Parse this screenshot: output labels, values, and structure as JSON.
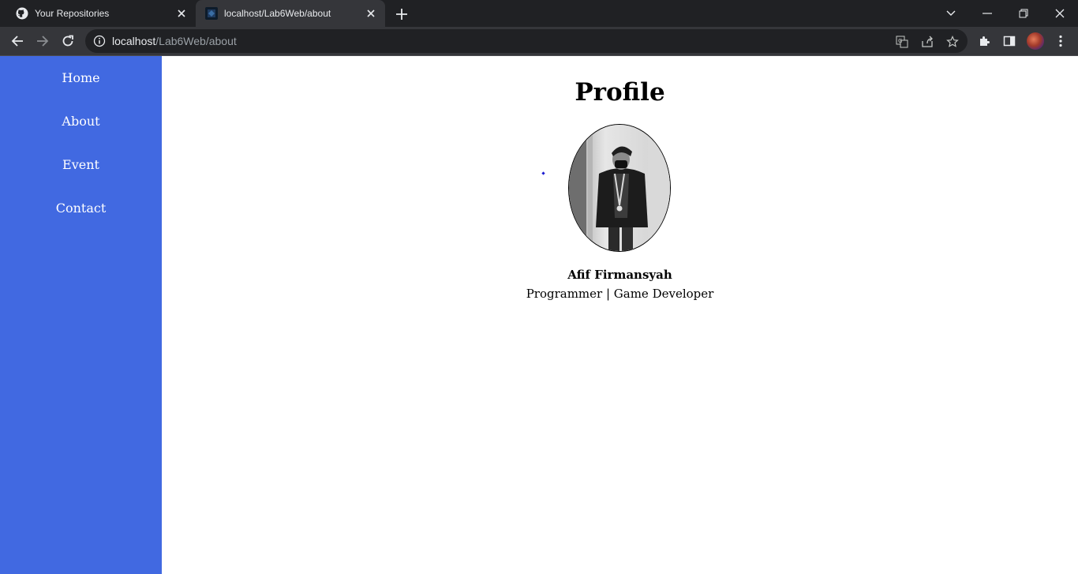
{
  "browser": {
    "tabs": [
      {
        "title": "Your Repositories",
        "icon": "github-icon",
        "active": false
      },
      {
        "title": "localhost/Lab6Web/about",
        "icon": "site-favicon",
        "active": true
      }
    ],
    "address": {
      "host": "localhost",
      "path": "/Lab6Web/about"
    }
  },
  "sidebar": {
    "color": "#4169e1",
    "items": [
      {
        "label": "Home"
      },
      {
        "label": "About"
      },
      {
        "label": "Event"
      },
      {
        "label": "Contact"
      }
    ]
  },
  "main": {
    "title": "Profile",
    "name": "Afif Firmansyah",
    "role": "Programmer | Game Developer"
  }
}
